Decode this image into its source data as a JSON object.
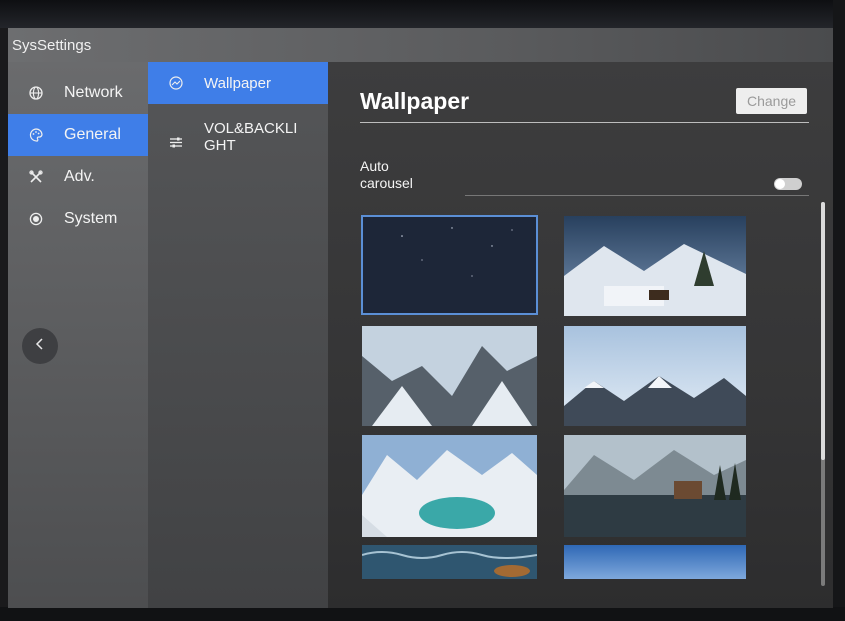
{
  "app": {
    "title": "SysSettings"
  },
  "nav": {
    "items": [
      {
        "label": "Network",
        "icon": "globe-icon",
        "active": false
      },
      {
        "label": "General",
        "icon": "palette-icon",
        "active": true
      },
      {
        "label": "Adv.",
        "icon": "tools-icon",
        "active": false
      },
      {
        "label": "System",
        "icon": "system-icon",
        "active": false
      }
    ],
    "back_icon": "chevron-left-icon"
  },
  "subnav": {
    "items": [
      {
        "label": "Wallpaper",
        "icon": "wallpaper-icon",
        "active": true
      },
      {
        "label": "VOL&BACKLIGHT",
        "label_line1": "VOL&BACKLI",
        "label_line2": "GHT",
        "icon": "sliders-icon",
        "active": false
      }
    ]
  },
  "main": {
    "title": "Wallpaper",
    "change_label": "Change",
    "auto_carousel_line1": "Auto",
    "auto_carousel_line2": "carousel",
    "auto_carousel_enabled": false
  },
  "colors": {
    "accent": "#3f7ee8",
    "selected_outline": "#5b8fd6"
  },
  "wallpapers": [
    {
      "name": "starry night sky",
      "selected": true
    },
    {
      "name": "snowy cabin village",
      "selected": false
    },
    {
      "name": "snowy mountain valley",
      "selected": false
    },
    {
      "name": "mountain peaks above clouds",
      "selected": false
    },
    {
      "name": "turquoise alpine lake",
      "selected": false
    },
    {
      "name": "lakeside lodge",
      "selected": false
    },
    {
      "name": "ocean waves",
      "selected": false
    },
    {
      "name": "blue sky horizon",
      "selected": false
    }
  ]
}
